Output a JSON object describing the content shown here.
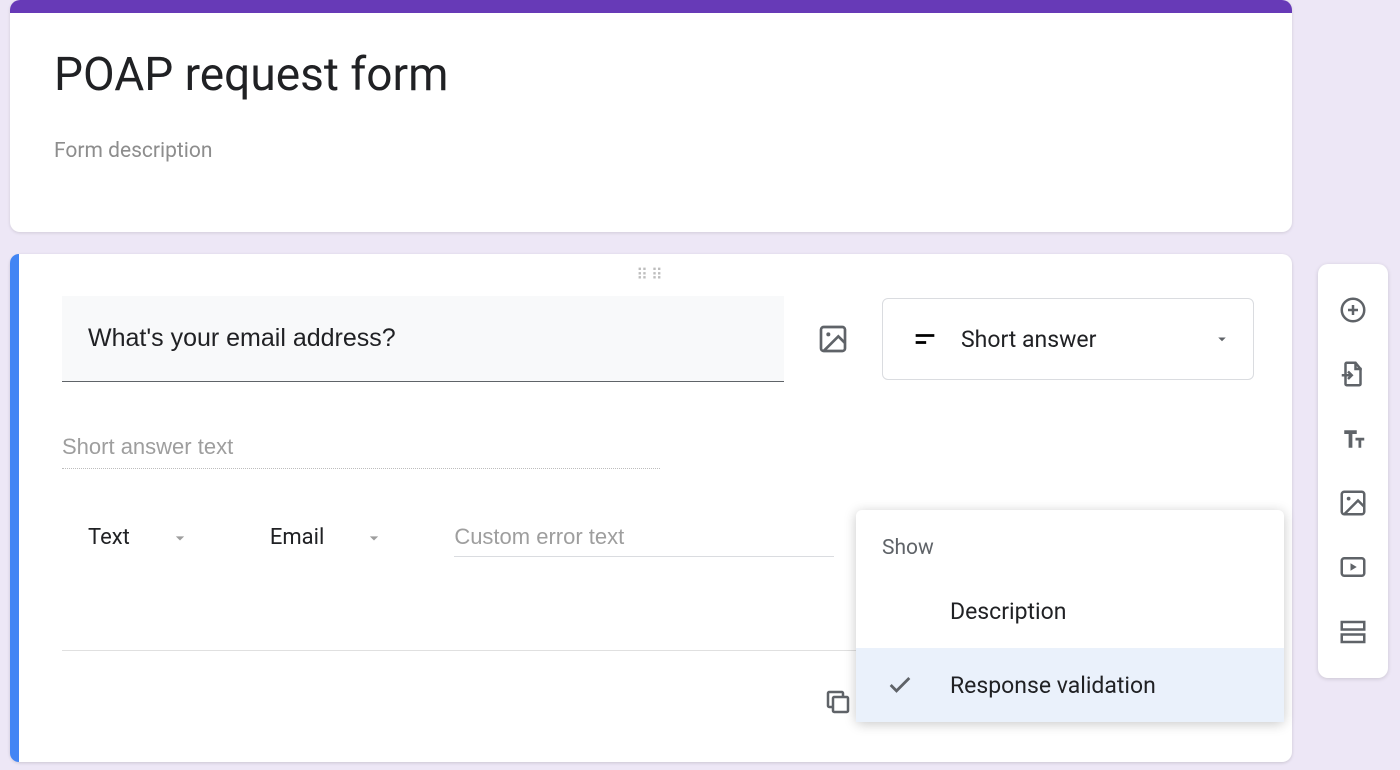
{
  "header": {
    "title": "POAP request form",
    "description_placeholder": "Form description"
  },
  "question": {
    "title": "What's your email address?",
    "answer_placeholder": "Short answer text",
    "type_label": "Short answer",
    "validation": {
      "type_label": "Text",
      "subtype_label": "Email",
      "error_placeholder": "Custom error text"
    }
  },
  "popup": {
    "header": "Show",
    "items": [
      {
        "label": "Description",
        "selected": false
      },
      {
        "label": "Response validation",
        "selected": true
      }
    ]
  },
  "toolbar": {
    "add_question": "add-question",
    "import_questions": "import-questions",
    "add_title": "add-title",
    "add_image": "add-image",
    "add_video": "add-video",
    "add_section": "add-section"
  }
}
